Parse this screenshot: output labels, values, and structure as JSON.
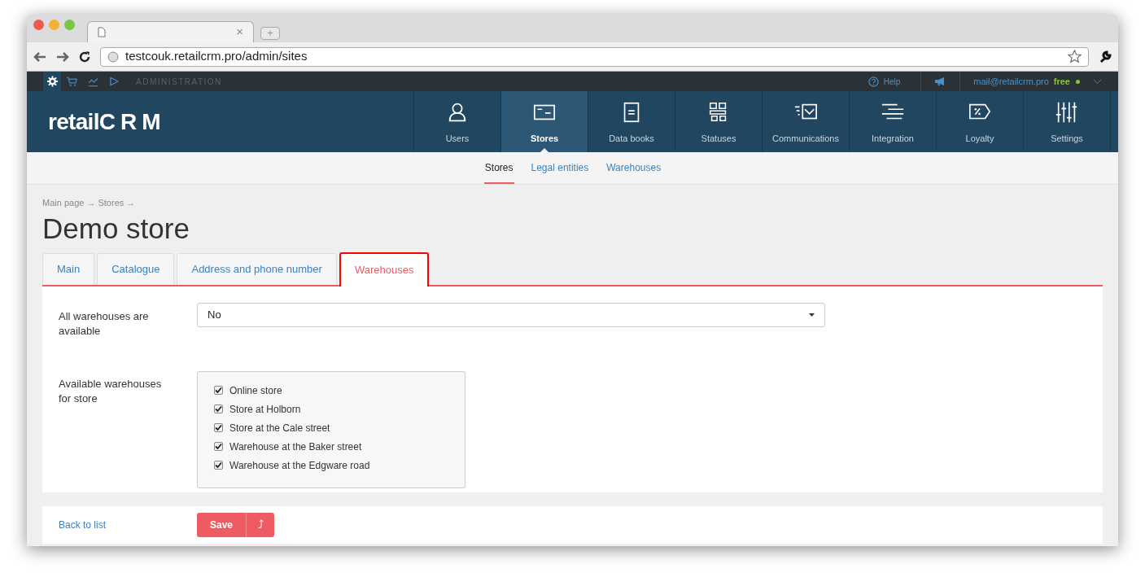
{
  "browser": {
    "tab_close": "×",
    "new_tab": "+",
    "url": "testcouk.retailcrm.pro/admin/sites"
  },
  "admin_bar": {
    "title": "ADMINISTRATION",
    "help": "Help",
    "email": "mail@retailcrm.pro",
    "plan": "free",
    "icons": [
      {
        "kind": "gear",
        "selected": true
      },
      {
        "kind": "cart",
        "selected": false
      },
      {
        "kind": "chart",
        "selected": false
      },
      {
        "kind": "play",
        "selected": false
      }
    ]
  },
  "logo": {
    "prefix": "retail",
    "suffix": "CRM"
  },
  "main_nav": [
    {
      "label": "Users",
      "kind": "user",
      "selected": false
    },
    {
      "label": "Stores",
      "kind": "store",
      "selected": true
    },
    {
      "label": "Data books",
      "kind": "book",
      "selected": false
    },
    {
      "label": "Statuses",
      "kind": "statuses",
      "selected": false
    },
    {
      "label": "Communications",
      "kind": "mail",
      "selected": false
    },
    {
      "label": "Integration",
      "kind": "lines",
      "selected": false
    },
    {
      "label": "Loyalty",
      "kind": "percent",
      "selected": false
    },
    {
      "label": "Settings",
      "kind": "sliders",
      "selected": false
    }
  ],
  "sub_nav": [
    {
      "label": "Stores",
      "selected": true
    },
    {
      "label": "Legal entities",
      "selected": false
    },
    {
      "label": "Warehouses",
      "selected": false
    }
  ],
  "breadcrumbs": "Main page → Stores →",
  "page_title": "Demo store",
  "tabs": [
    {
      "label": "Main",
      "selected": false
    },
    {
      "label": "Catalogue",
      "selected": false
    },
    {
      "label": "Address and phone number",
      "selected": false
    },
    {
      "label": "Warehouses",
      "selected": true
    }
  ],
  "form": {
    "all_available_label": "All warehouses are available",
    "all_available_value": "No",
    "available_label": "Available warehouses for store",
    "warehouses": [
      {
        "label": "Online store",
        "checked": true
      },
      {
        "label": "Store at Holborn",
        "checked": true
      },
      {
        "label": "Store at the Cale street",
        "checked": true
      },
      {
        "label": "Warehouse at the Baker street",
        "checked": true
      },
      {
        "label": "Warehouse at the Edgware road",
        "checked": true
      }
    ]
  },
  "footer": {
    "back_link": "Back to list",
    "save": "Save",
    "save_extra": "⤴"
  }
}
